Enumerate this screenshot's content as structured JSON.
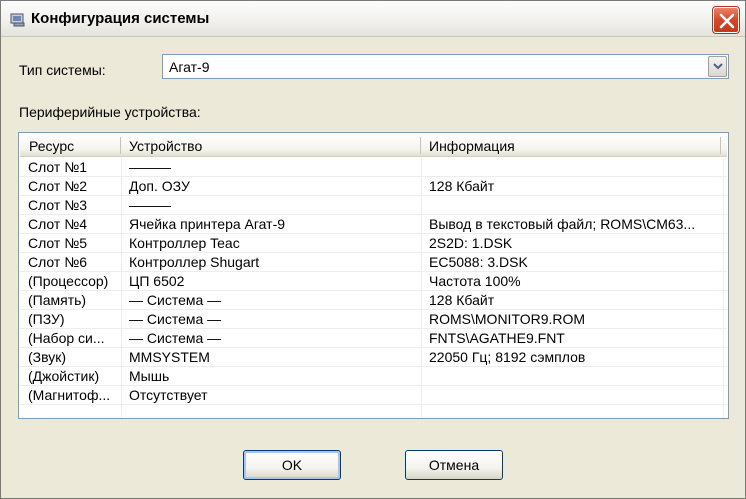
{
  "window": {
    "title": "Конфигурация системы"
  },
  "system_type": {
    "label": "Тип системы:",
    "selected": "Агат-9"
  },
  "peripherals": {
    "label": "Периферийные устройства:",
    "columns": [
      "Ресурс",
      "Устройство",
      "Информация"
    ],
    "rows": [
      {
        "resource": "Слот №1",
        "device": "———",
        "info": ""
      },
      {
        "resource": "Слот №2",
        "device": "Доп. ОЗУ",
        "info": "128 Кбайт"
      },
      {
        "resource": "Слот №3",
        "device": "———",
        "info": ""
      },
      {
        "resource": "Слот №4",
        "device": "Ячейка принтера Агат-9",
        "info": "Вывод в текстовый файл; ROMS\\CM63..."
      },
      {
        "resource": "Слот №5",
        "device": "Контроллер Teac",
        "info": "2S2D: 1.DSK"
      },
      {
        "resource": "Слот №6",
        "device": "Контроллер Shugart",
        "info": "EC5088: 3.DSK"
      },
      {
        "resource": "(Процессор)",
        "device": "ЦП 6502",
        "info": "Частота 100%"
      },
      {
        "resource": "(Память)",
        "device": "— Система —",
        "info": "128 Кбайт"
      },
      {
        "resource": "(ПЗУ)",
        "device": "— Система —",
        "info": "ROMS\\MONITOR9.ROM"
      },
      {
        "resource": "(Набор си...",
        "device": "— Система —",
        "info": "FNTS\\AGATHE9.FNT"
      },
      {
        "resource": "(Звук)",
        "device": "MMSYSTEM",
        "info": "22050 Гц; 8192 сэмплов"
      },
      {
        "resource": "(Джойстик)",
        "device": "Мышь",
        "info": ""
      },
      {
        "resource": "(Магнитоф...",
        "device": "Отсутствует",
        "info": ""
      }
    ]
  },
  "buttons": {
    "ok": "OK",
    "cancel": "Отмена"
  },
  "colors": {
    "dialog_bg": "#ECE9D8",
    "close_button": "#D5472A",
    "border": "#7F9DB9"
  }
}
